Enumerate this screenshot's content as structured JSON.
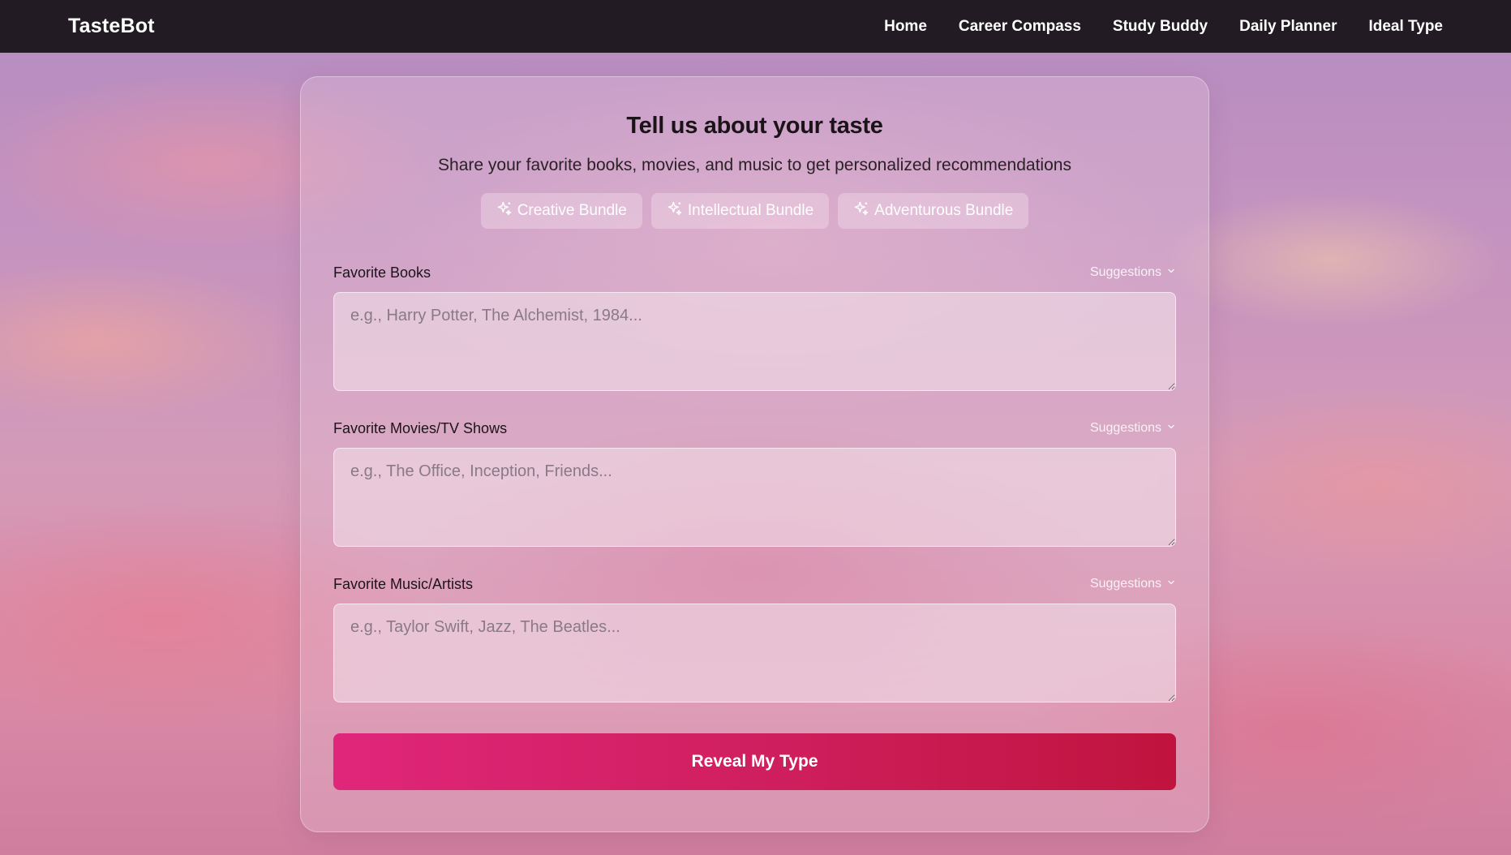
{
  "navbar": {
    "brand": "TasteBot",
    "links": [
      "Home",
      "Career Compass",
      "Study Buddy",
      "Daily Planner",
      "Ideal Type"
    ]
  },
  "form": {
    "title": "Tell us about your taste",
    "subtitle": "Share your favorite books, movies, and music to get personalized recommendations",
    "bundles": [
      {
        "label": "Creative Bundle",
        "icon": "sparkles-icon"
      },
      {
        "label": "Intellectual Bundle",
        "icon": "sparkles-icon"
      },
      {
        "label": "Adventurous Bundle",
        "icon": "sparkles-icon"
      }
    ],
    "fields": [
      {
        "label": "Favorite Books",
        "placeholder": "e.g., Harry Potter, The Alchemist, 1984...",
        "value": "",
        "suggestions_label": "Suggestions"
      },
      {
        "label": "Favorite Movies/TV Shows",
        "placeholder": "e.g., The Office, Inception, Friends...",
        "value": "",
        "suggestions_label": "Suggestions"
      },
      {
        "label": "Favorite Music/Artists",
        "placeholder": "e.g., Taylor Swift, Jazz, The Beatles...",
        "value": "",
        "suggestions_label": "Suggestions"
      }
    ],
    "submit_label": "Reveal My Type"
  },
  "colors": {
    "navbar_bg": "#221b23",
    "submit_gradient_start": "#e0267a",
    "submit_gradient_end": "#c0143e"
  }
}
